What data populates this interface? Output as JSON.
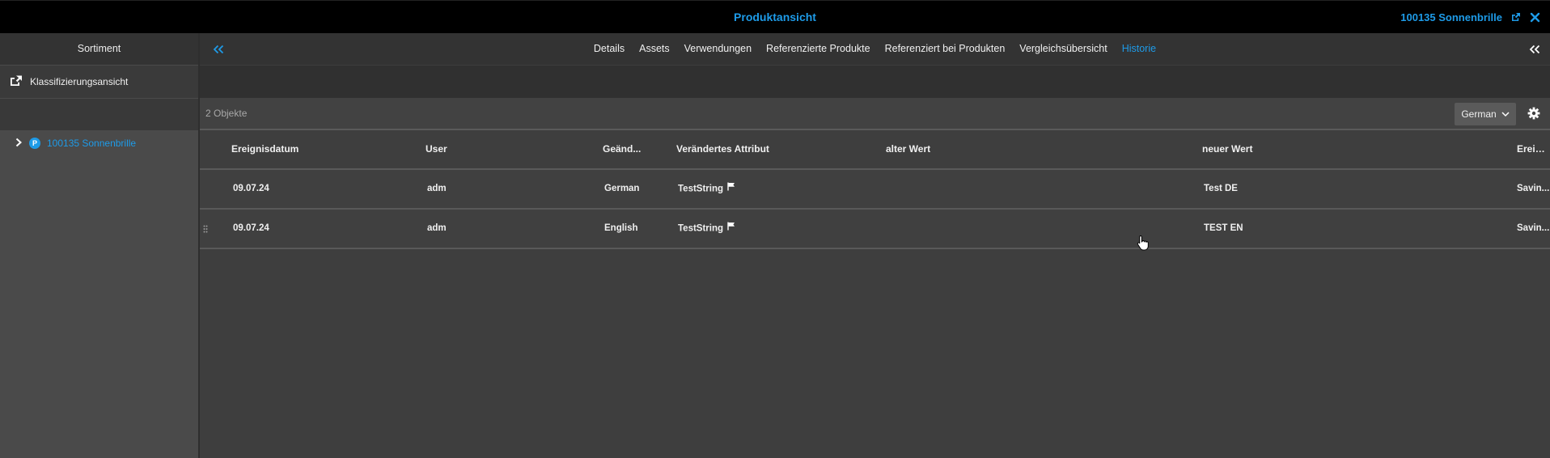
{
  "header": {
    "title": "Produktansicht",
    "product_ref": "100135 Sonnenbrille",
    "icons": [
      "external-link-icon",
      "close-icon"
    ]
  },
  "sidebar": {
    "title": "Sortiment",
    "toolbar_label": "Klassifizierungsansicht",
    "tree": [
      {
        "badge": "P",
        "label": "100135 Sonnenbrille",
        "expanded": false
      }
    ]
  },
  "tabs": [
    {
      "label": "Details",
      "active": false
    },
    {
      "label": "Assets",
      "active": false
    },
    {
      "label": "Verwendungen",
      "active": false
    },
    {
      "label": "Referenzierte Produkte",
      "active": false
    },
    {
      "label": "Referenziert bei Produkten",
      "active": false
    },
    {
      "label": "Vergleichsübersicht",
      "active": false
    },
    {
      "label": "Historie",
      "active": true
    }
  ],
  "toolbar": {
    "object_count": "2 Objekte",
    "language": "German"
  },
  "table": {
    "columns": [
      "Ereignisdatum",
      "User",
      "Geänd...",
      "Verändertes Attribut",
      "alter Wert",
      "neuer Wert",
      "Ereign..."
    ],
    "rows": [
      [
        "09.07.24",
        "adm",
        "German",
        "TestString",
        "",
        "Test DE",
        "Savin..."
      ],
      [
        "09.07.24",
        "adm",
        "English",
        "TestString",
        "",
        "TEST EN",
        "Savin..."
      ]
    ]
  },
  "colors": {
    "accent": "#1e9be8",
    "topbar": "#000000",
    "background": "#3e3e3e"
  }
}
